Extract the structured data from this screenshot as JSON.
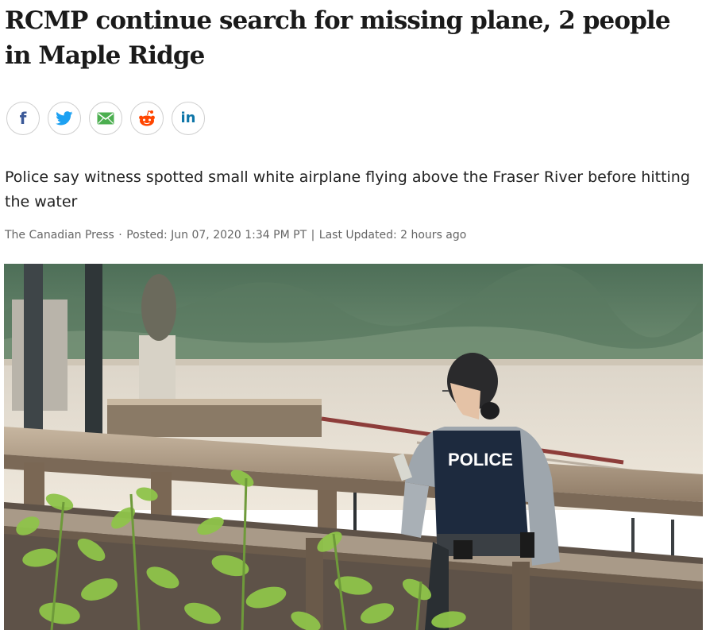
{
  "article": {
    "headline": "RCMP continue search for missing plane, 2 people in Maple Ridge",
    "deck": "Police say witness spotted small white airplane flying above the Fraser River before hitting the water",
    "byline": {
      "source": "The Canadian Press",
      "separator_dot": "·",
      "posted_label": "Posted:",
      "posted_date": "Jun 07, 2020 1:34 PM PT",
      "separator_bar": "|",
      "updated_label": "Last Updated:",
      "updated_value": "2 hours ago"
    }
  },
  "share": {
    "buttons": [
      {
        "network": "facebook",
        "icon": "facebook-icon",
        "glyph": "f",
        "color": "#3b5998"
      },
      {
        "network": "twitter",
        "icon": "twitter-icon",
        "color": "#1da1f2"
      },
      {
        "network": "email",
        "icon": "email-icon",
        "color": "#4caf50"
      },
      {
        "network": "reddit",
        "icon": "reddit-icon",
        "color": "#ff4500"
      },
      {
        "network": "linkedin",
        "icon": "linkedin-icon",
        "glyph": "in",
        "color": "#0e76a8"
      }
    ]
  },
  "hero_image": {
    "vest_text": "POLICE"
  }
}
